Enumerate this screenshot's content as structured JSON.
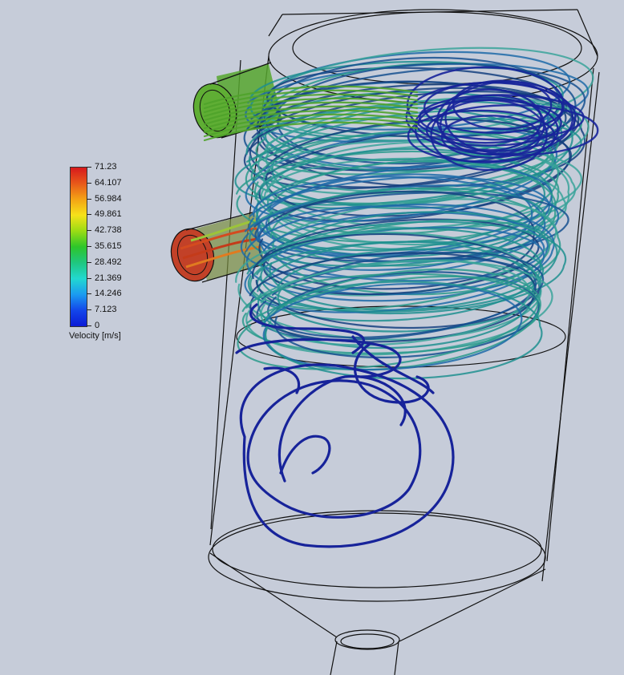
{
  "legend": {
    "title": "Velocity [m/s]",
    "ticks": [
      "71.23",
      "64.107",
      "56.984",
      "49.861",
      "42.738",
      "35.615",
      "28.492",
      "21.369",
      "14.246",
      "7.123",
      "0"
    ],
    "colors": [
      "#d7191c",
      "#e8581a",
      "#f4a315",
      "#f6e21a",
      "#9bdc14",
      "#2dc62a",
      "#1fc77f",
      "#22d8d0",
      "#1b9bf0",
      "#1346ea",
      "#0b1bd6"
    ]
  },
  "scene": {
    "background": "#c6ccd9",
    "outline_color": "#111111",
    "streamline_colors": {
      "inlet_top": "#4fa32a",
      "inlet_bottom_hot": "#c0392b",
      "swirl_main": "#1f8f8f",
      "swirl_dark": "#16508f",
      "vortex_core": "#17239a"
    }
  }
}
